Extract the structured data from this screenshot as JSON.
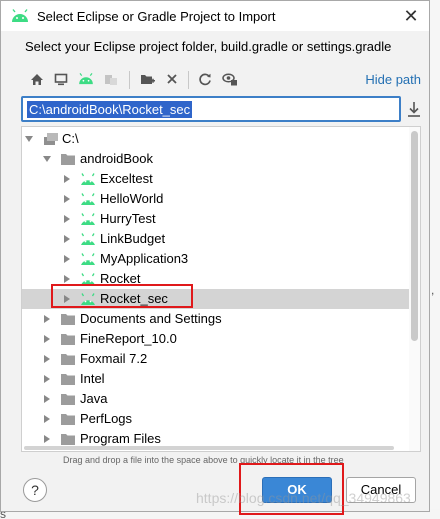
{
  "window": {
    "title": "Select Eclipse or Gradle Project to Import",
    "close_glyph": "✕"
  },
  "subtitle": "Select your Eclipse project folder, build.gradle or settings.gradle",
  "toolbar": {
    "buttons": [
      "home-icon",
      "desktop-icon",
      "android-project-icon",
      "module-icon",
      "new-folder-icon",
      "delete-icon",
      "refresh-icon",
      "show-hidden-icon"
    ],
    "hide_path_label": "Hide path"
  },
  "path_field": {
    "value": "C:\\androidBook\\Rocket_sec"
  },
  "tree": {
    "root": "C:\\",
    "items": [
      {
        "label": "androidBook",
        "icon": "folder-icon",
        "expanded": true
      },
      {
        "label": "Exceltest",
        "icon": "android-icon"
      },
      {
        "label": "HelloWorld",
        "icon": "android-icon"
      },
      {
        "label": "HurryTest",
        "icon": "android-icon"
      },
      {
        "label": "LinkBudget",
        "icon": "android-icon"
      },
      {
        "label": "MyApplication3",
        "icon": "android-icon"
      },
      {
        "label": "Rocket",
        "icon": "android-icon"
      },
      {
        "label": "Rocket_sec",
        "icon": "android-icon",
        "selected": true
      },
      {
        "label": "Documents and Settings",
        "icon": "folder-icon"
      },
      {
        "label": "FineReport_10.0",
        "icon": "folder-icon"
      },
      {
        "label": "Foxmail 7.2",
        "icon": "folder-icon"
      },
      {
        "label": "Intel",
        "icon": "folder-icon"
      },
      {
        "label": "Java",
        "icon": "folder-icon"
      },
      {
        "label": "PerfLogs",
        "icon": "folder-icon"
      },
      {
        "label": "Program Files",
        "icon": "folder-icon"
      }
    ]
  },
  "hint": "Drag and drop a file into the space above to quickly locate it in the tree",
  "buttons": {
    "help": "?",
    "ok": "OK",
    "cancel": "Cancel"
  },
  "watermark": "https://blog.csdn.net/qq_34949863",
  "background_fragments": {
    "right": ",",
    "left": "s"
  },
  "colors": {
    "android_green": "#3ddc84",
    "accent_blue": "#3a87d6",
    "selection_blue": "#2f65ca",
    "link_blue": "#2470b3",
    "highlight_red": "#e0191b"
  }
}
